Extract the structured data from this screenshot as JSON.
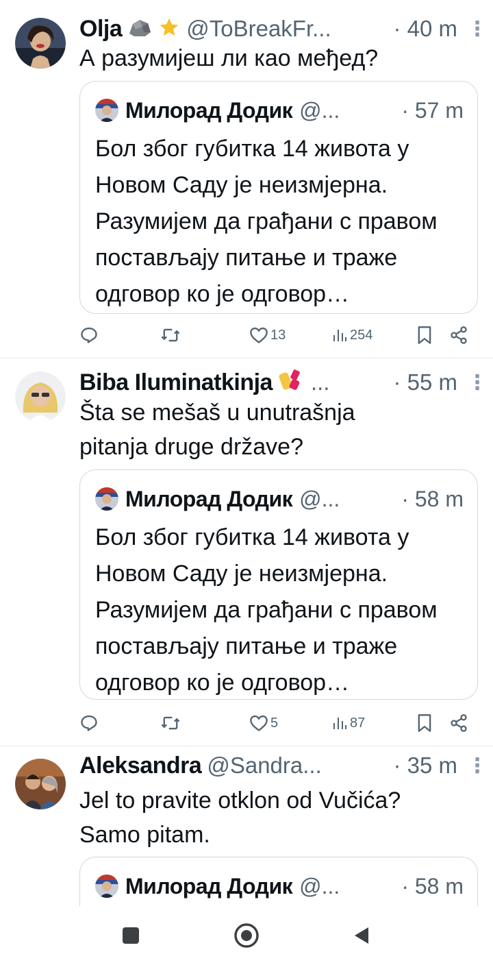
{
  "tweets": [
    {
      "name": "Olja",
      "name_emojis": [
        "rock",
        "star"
      ],
      "handle": "@ToBreakFr...",
      "time": "· 40 m",
      "text": "А разумијеш ли као међед?",
      "quote": {
        "name": "Милорад Додик",
        "handle": "@...",
        "time": "· 57 m",
        "text": "Бол због губитка 14 живота у Новом Саду је неизмјерна. Разумијем да грађани с правом постављају питање и траже одговор ко је одговор…"
      },
      "likes": "13",
      "views": "254"
    },
    {
      "name": "Biba Iluminatkinja",
      "name_emojis": [
        "nail-polish"
      ],
      "handle": "...",
      "time": "· 55 m",
      "text": "Šta se mešaš u unutrašnja pitanja druge države?",
      "quote": {
        "name": "Милорад Додик",
        "handle": "@...",
        "time": "· 58 m",
        "text": "Бол због губитка 14 живота у Новом Саду је неизмјерна. Разумијем да грађани с правом постављају питање и траже одговор ко је одговор…"
      },
      "likes": "5",
      "views": "87"
    },
    {
      "name": "Aleksandra",
      "handle": "@Sandra...",
      "time": "· 35 m",
      "text": "Jel to pravite otklon od Vučića? Samo pitam.",
      "quote": {
        "name": "Милорад Додик",
        "handle": "@...",
        "time": "· 58 m"
      }
    }
  ],
  "icons": {
    "reply": "reply-icon",
    "retweet": "retweet-icon",
    "like": "heart-icon",
    "views": "views-icon",
    "bookmark": "bookmark-icon",
    "share": "share-icon",
    "more": "more-icon"
  },
  "colors": {
    "text": "#0f1419",
    "secondary": "#536471",
    "border": "#cfd9de",
    "divider": "#e6e9eb"
  }
}
